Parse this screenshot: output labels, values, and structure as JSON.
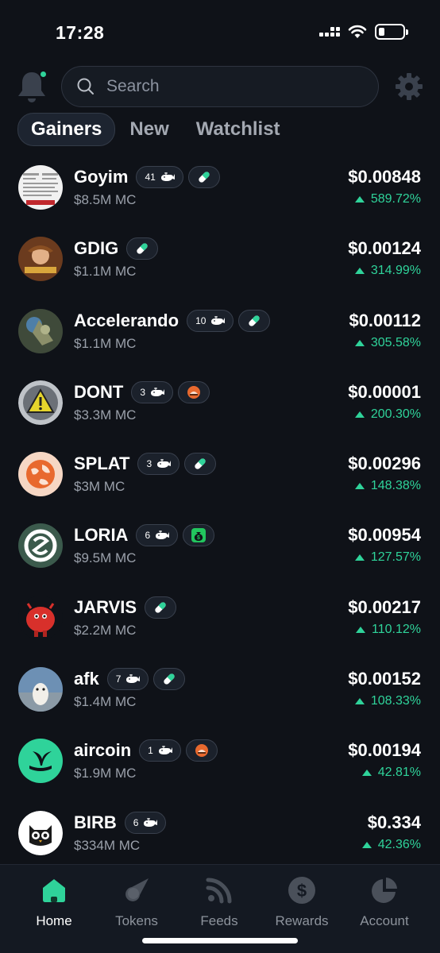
{
  "status_bar": {
    "time": "17:28"
  },
  "search": {
    "placeholder": "Search"
  },
  "tabs": [
    {
      "label": "Gainers",
      "active": true
    },
    {
      "label": "New",
      "active": false
    },
    {
      "label": "Watchlist",
      "active": false
    }
  ],
  "tokens": [
    {
      "name": "Goyim",
      "mc": "$8.5M MC",
      "price": "$0.00848",
      "change": "589.72%",
      "whale_count": "41",
      "badge2": "pill-icon"
    },
    {
      "name": "GDIG",
      "mc": "$1.1M MC",
      "price": "$0.00124",
      "change": "314.99%",
      "whale_count": null,
      "badge2": "pill-icon"
    },
    {
      "name": "Accelerando",
      "mc": "$1.1M MC",
      "price": "$0.00112",
      "change": "305.58%",
      "whale_count": "10",
      "badge2": "pill-icon"
    },
    {
      "name": "DONT",
      "mc": "$3.3M MC",
      "price": "$0.00001",
      "change": "200.30%",
      "whale_count": "3",
      "badge2": "platform-icon"
    },
    {
      "name": "SPLAT",
      "mc": "$3M MC",
      "price": "$0.00296",
      "change": "148.38%",
      "whale_count": "3",
      "badge2": "pill-icon"
    },
    {
      "name": "LORIA",
      "mc": "$9.5M MC",
      "price": "$0.00954",
      "change": "127.57%",
      "whale_count": "6",
      "badge2": "money-bag-icon"
    },
    {
      "name": "JARVIS",
      "mc": "$2.2M MC",
      "price": "$0.00217",
      "change": "110.12%",
      "whale_count": null,
      "badge2": "pill-icon"
    },
    {
      "name": "afk",
      "mc": "$1.4M MC",
      "price": "$0.00152",
      "change": "108.33%",
      "whale_count": "7",
      "badge2": "pill-icon"
    },
    {
      "name": "aircoin",
      "mc": "$1.9M MC",
      "price": "$0.00194",
      "change": "42.81%",
      "whale_count": "1",
      "badge2": "platform-icon"
    },
    {
      "name": "BIRB",
      "mc": "$334M MC",
      "price": "$0.334",
      "change": "42.36%",
      "whale_count": "6",
      "badge2": null
    }
  ],
  "nav": [
    {
      "label": "Home",
      "icon": "home-icon",
      "active": true
    },
    {
      "label": "Tokens",
      "icon": "comet-icon",
      "active": false
    },
    {
      "label": "Feeds",
      "icon": "rss-icon",
      "active": false
    },
    {
      "label": "Rewards",
      "icon": "dollar-coin-icon",
      "active": false
    },
    {
      "label": "Account",
      "icon": "pie-chart-icon",
      "active": false
    }
  ],
  "colors": {
    "accent_green": "#2fd39a",
    "background": "#0f1218"
  }
}
